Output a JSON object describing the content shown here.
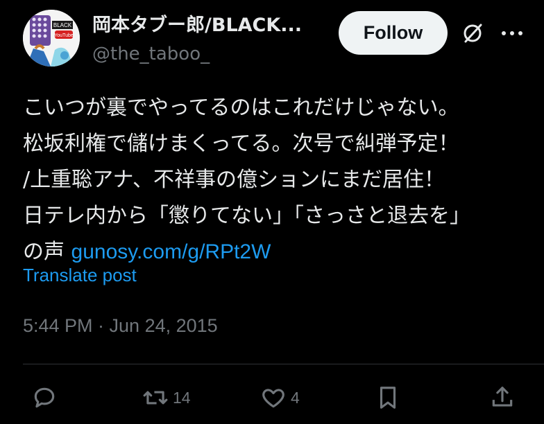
{
  "author": {
    "display_name": "岡本タブー郎/BLACK...",
    "handle": "@the_taboo_",
    "avatar_text_top": "BLACK",
    "avatar_text_bottom": "YouTube"
  },
  "header": {
    "follow_label": "Follow",
    "grok_icon": "slashed-circle-icon",
    "more_icon": "more-dots-icon"
  },
  "post": {
    "lines": [
      "こいつが裏でやってるのはこれだけじゃない。",
      "松坂利権で儲けまくってる。次号で糾弾予定！",
      "/上重聡アナ、不祥事の億ションにまだ居住！",
      "日テレ内から「懲りてない」「さっさと退去を」",
      "の声 "
    ],
    "link": "gunosy.com/g/RPt2W",
    "translate_label": "Translate post",
    "timestamp": "5:44 PM · Jun 24, 2015"
  },
  "actions": {
    "reply_icon": "reply-icon",
    "repost_icon": "repost-icon",
    "repost_count": "14",
    "like_icon": "heart-icon",
    "like_count": "4",
    "bookmark_icon": "bookmark-icon",
    "share_icon": "share-icon"
  },
  "colors": {
    "background": "#000000",
    "text": "#e7e9ea",
    "secondary": "#71767b",
    "link": "#1d9bf0",
    "follow_bg": "#eff3f4"
  }
}
